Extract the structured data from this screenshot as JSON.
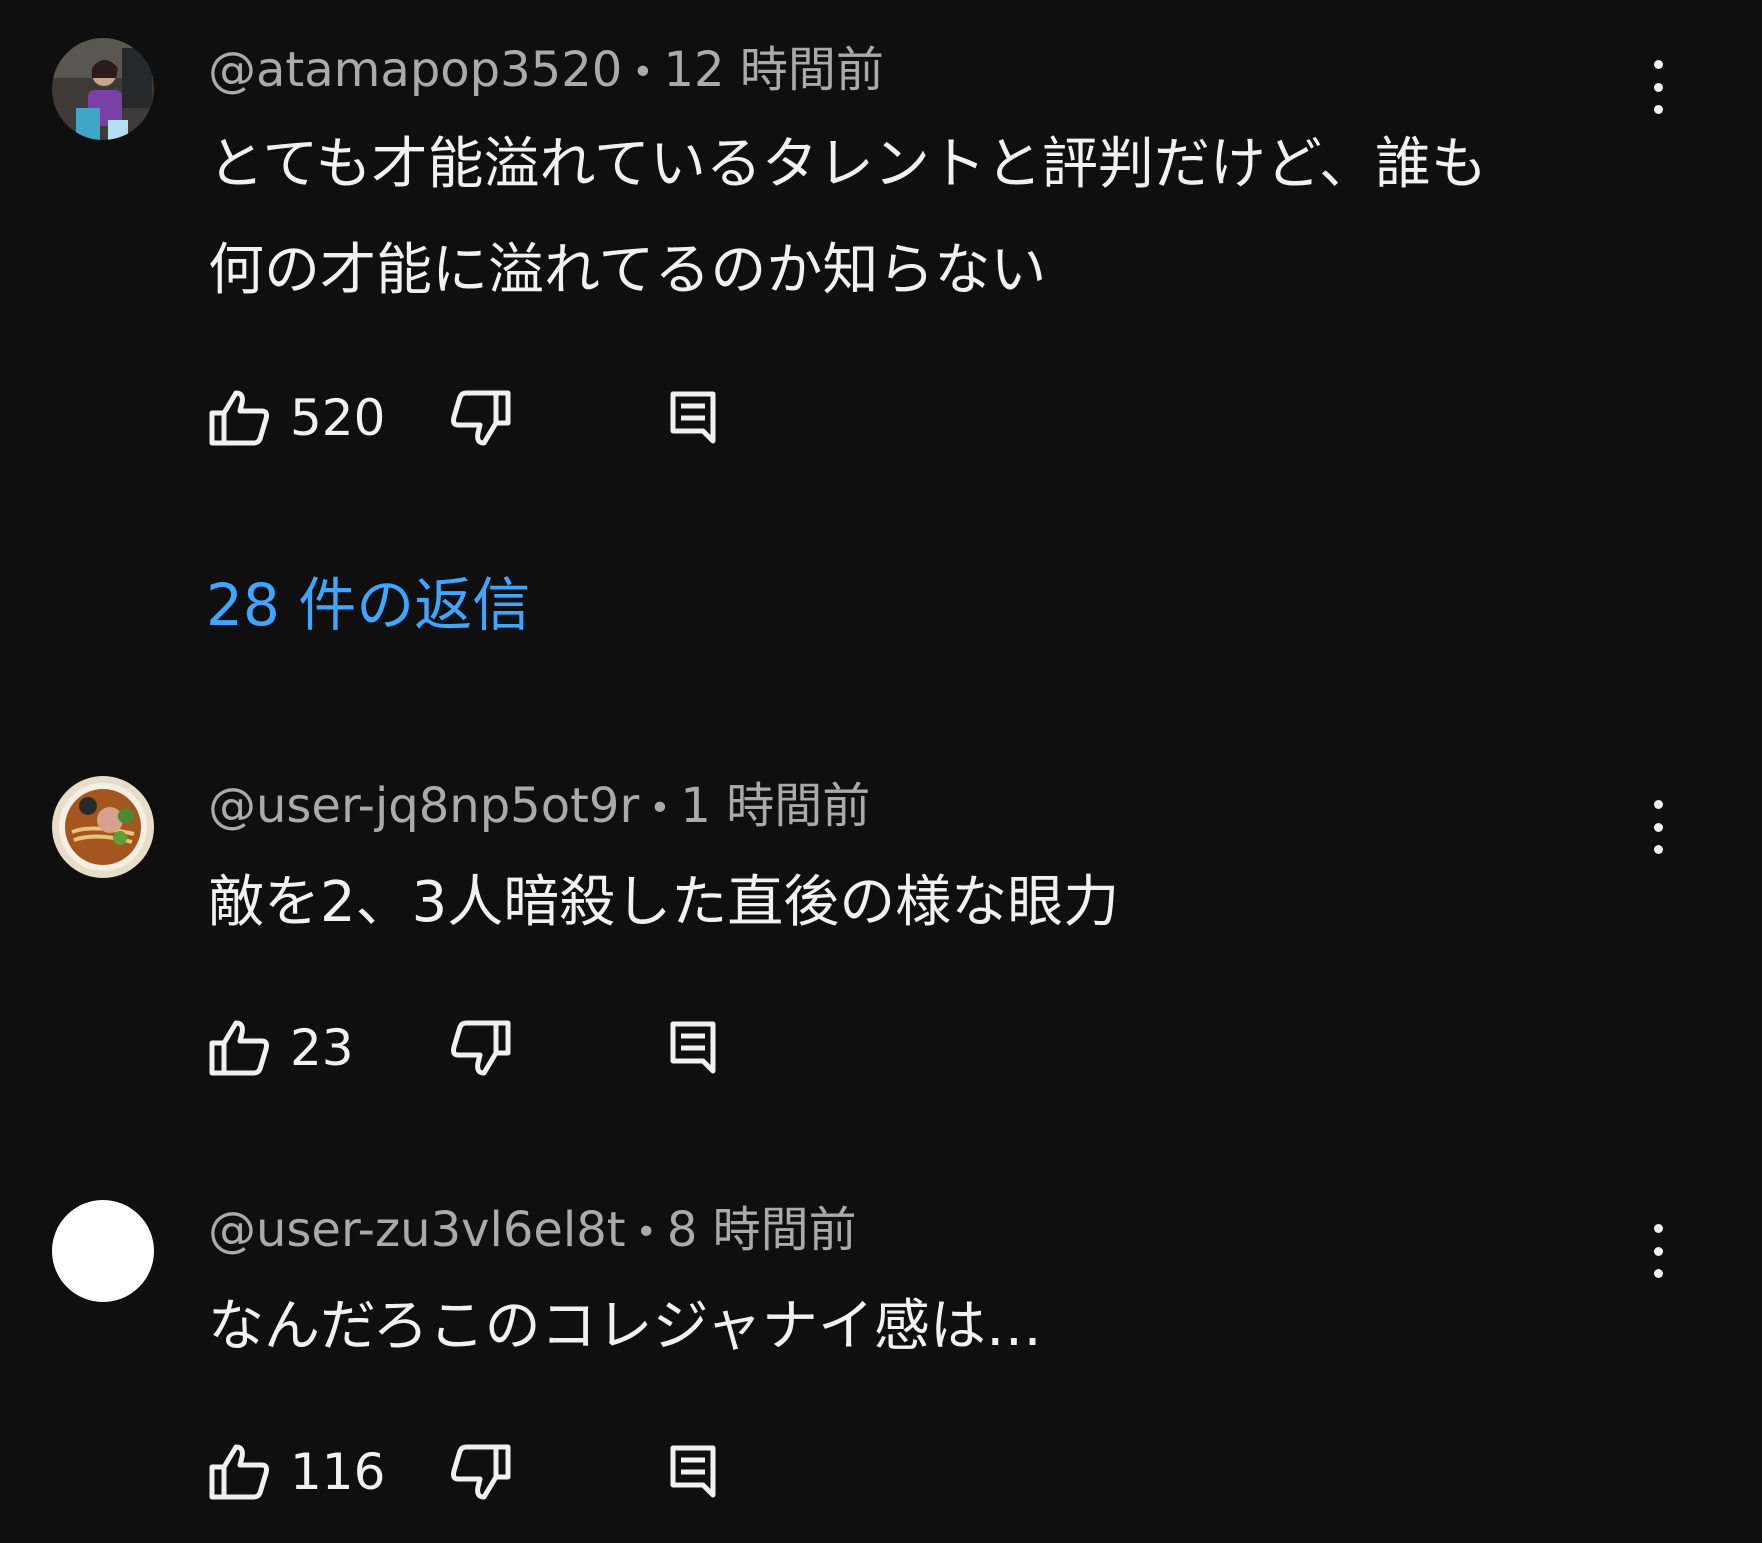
{
  "comments": [
    {
      "author": "@atamapop3520",
      "time": "12 時間前",
      "text": "とても才能溢れているタレントと評判だけど、誰も\n何の才能に溢れてるのか知らない",
      "likes": "520"
    },
    {
      "author": "@user-jq8np5ot9r",
      "time": "1 時間前",
      "text": "敵を2、3人暗殺した直後の様な眼力",
      "likes": "23"
    },
    {
      "author": "@user-zu3vl6el8t",
      "time": "8 時間前",
      "text": "なんだろこのコレジャナイ感は…",
      "likes": "116"
    }
  ],
  "replies_label": "28 件の返信",
  "separator": "•",
  "colors": {
    "background": "#0f0f0f",
    "text": "#f1f1f1",
    "meta": "#aaaaaa",
    "link": "#3ea6ff"
  },
  "icons": [
    "like-icon",
    "dislike-icon",
    "reply-icon",
    "more-vert-icon"
  ]
}
